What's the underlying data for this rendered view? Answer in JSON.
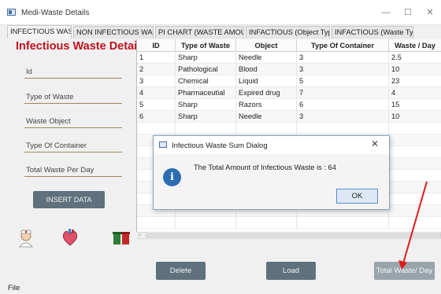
{
  "window": {
    "title": "Medi-Waste Details",
    "minimize": "—",
    "maximize": "☐",
    "close": "✕"
  },
  "tabs": [
    "INFECTIOUS WASTE",
    "NON INFECTIOUS WASTE",
    "PI CHART (WASTE AMOUNT)",
    "INFACTIOUS (Object Type)",
    "INFACTIOUS (Waste Type)"
  ],
  "form": {
    "title": "Infectious Waste Details",
    "fields": [
      "Id",
      "Type of Waste",
      "Waste Object",
      "Type Of Container",
      "Total Waste Per Day"
    ],
    "insert_label": "INSERT DATA"
  },
  "table": {
    "columns": [
      "ID",
      "Type of Waste",
      "Object",
      "Type Of Container",
      "Waste / Day"
    ],
    "rows": [
      [
        "1",
        "Sharp",
        "Needle",
        "3",
        "2.5"
      ],
      [
        "2",
        "Pathological",
        "Blood",
        "3",
        "10"
      ],
      [
        "3",
        "Chemical",
        "Liquid",
        "5",
        "23"
      ],
      [
        "4",
        "Pharmaceutial",
        "Expired drug",
        "7",
        "4"
      ],
      [
        "5",
        "Sharp",
        "Razors",
        "6",
        "15"
      ],
      [
        "6",
        "Sharp",
        "Needle",
        "3",
        "10"
      ]
    ]
  },
  "buttons": {
    "delete": "Delete",
    "load": "Load",
    "total": "Total Waste/ Day"
  },
  "menu": {
    "file": "File"
  },
  "dialog": {
    "title": "Infectious Waste Sum Dialog",
    "message": "The Total Amount of Infectious Waste is : 64",
    "ok": "OK",
    "close": "✕"
  },
  "icons": [
    "medical-staff-icon",
    "heart-organ-icon",
    "waste-bins-icon",
    "info-icon"
  ],
  "colors": {
    "title_red": "#c1121f",
    "button": "#5e717c",
    "annotation_arrow": "#e01b1b"
  }
}
